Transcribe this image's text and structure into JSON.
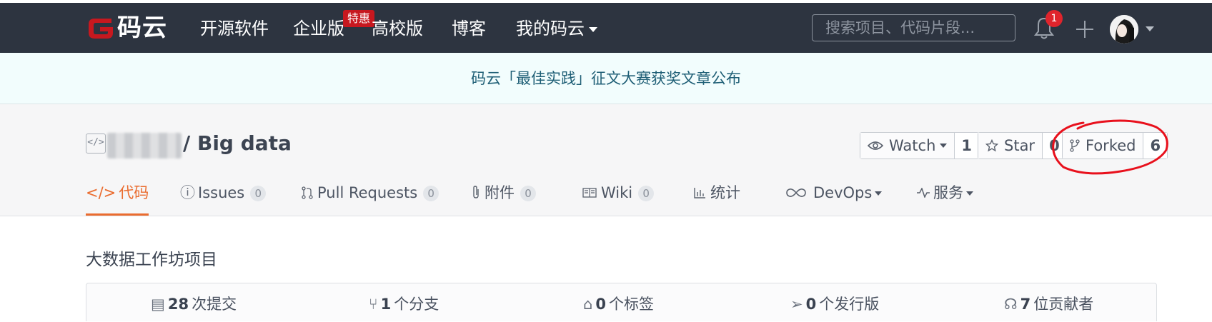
{
  "header": {
    "logo_text": "码云",
    "nav": [
      "开源软件",
      "企业版",
      "高校版",
      "博客",
      "我的码云"
    ],
    "hot_badge": "特惠",
    "search_placeholder": "搜索项目、代码片段...",
    "notification_count": "1"
  },
  "announcement": "码云「最佳实践」征文大赛获奖文章公布",
  "repo": {
    "name": "/ Big data",
    "watch": {
      "label": "Watch",
      "count": "1"
    },
    "star": {
      "label": "Star",
      "count": "0"
    },
    "fork": {
      "label": "Forked",
      "count": "6"
    }
  },
  "tabs": [
    {
      "label": "代码"
    },
    {
      "label": "Issues",
      "count": "0"
    },
    {
      "label": "Pull Requests",
      "count": "0"
    },
    {
      "label": "附件",
      "count": "0"
    },
    {
      "label": "Wiki",
      "count": "0"
    },
    {
      "label": "统计"
    },
    {
      "label": "DevOps"
    },
    {
      "label": "服务"
    }
  ],
  "description": "大数据工作坊项目",
  "stats": [
    {
      "value": "28",
      "label": "次提交"
    },
    {
      "value": "1",
      "label": "个分支"
    },
    {
      "value": "0",
      "label": "个标签"
    },
    {
      "value": "0",
      "label": "个发行版"
    },
    {
      "value": "7",
      "label": "位贡献者"
    }
  ],
  "colors": {
    "topbar": "#2d3440",
    "accent": "#ea6c2f",
    "brand_red": "#c7181f",
    "annotation": "#e8101c"
  }
}
